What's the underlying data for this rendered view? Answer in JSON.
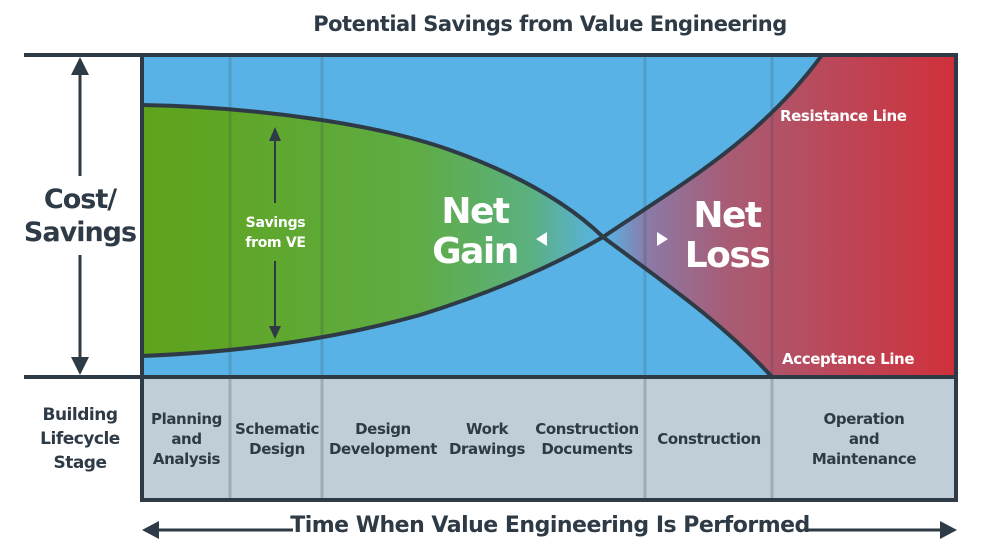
{
  "title": "Potential Savings from Value Engineering",
  "y_axis_label": [
    "Cost/",
    "Savings"
  ],
  "x_axis_label": "Time When Value Engineering Is Performed",
  "stage_header": [
    "Building",
    "Lifecycle",
    "Stage"
  ],
  "stages": [
    {
      "label": [
        "Planning",
        "and",
        "Analysis"
      ]
    },
    {
      "label": [
        "Schematic",
        "Design"
      ]
    },
    {
      "label": [
        "Design",
        "Development"
      ]
    },
    {
      "label": [
        "Work",
        "Drawings"
      ]
    },
    {
      "label": [
        "Construction",
        "Documents"
      ]
    },
    {
      "label": [
        "Construction"
      ]
    },
    {
      "label": [
        "Operation",
        "and",
        "Maintenance"
      ]
    }
  ],
  "annotations": {
    "savings_from_ve": [
      "Savings",
      "from VE"
    ],
    "net_gain": [
      "Net",
      "Gain"
    ],
    "net_loss": [
      "Net",
      "Loss"
    ],
    "resistance_line": "Resistance Line",
    "acceptance_line": "Acceptance Line"
  },
  "colors": {
    "background_blue": "#58b2e5",
    "gain_green": "#5fa31a",
    "loss_red": "#d0303a",
    "dark": "#2e3b46",
    "stage_band": "#c0ced7"
  }
}
